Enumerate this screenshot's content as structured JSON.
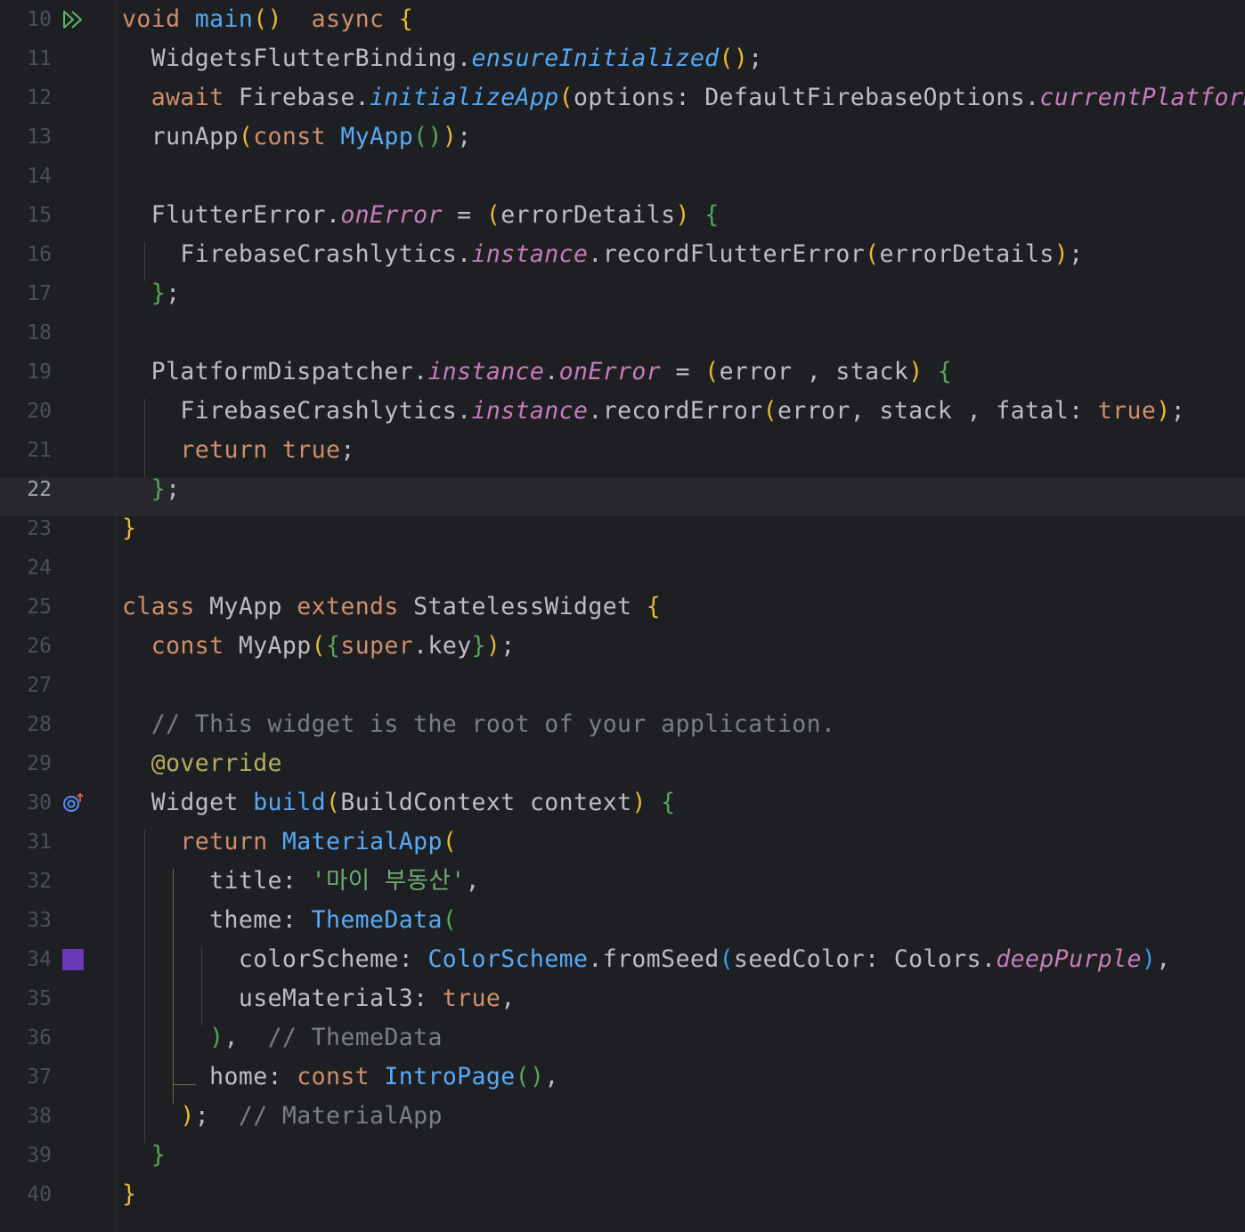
{
  "editor": {
    "active_line": "22",
    "swatch_color": "#673ab7",
    "lines": [
      {
        "n": "10",
        "icon": "run-gutter-icon",
        "segments": [
          [
            "kw",
            "void "
          ],
          [
            "fn",
            "main"
          ],
          [
            "p1",
            "()"
          ],
          [
            "",
            "  "
          ],
          [
            "kw",
            "async "
          ],
          [
            "p1",
            "{"
          ]
        ]
      },
      {
        "n": "11",
        "segments": [
          [
            "",
            "  WidgetsFlutterBinding."
          ],
          [
            "itb",
            "ensureInitialized"
          ],
          [
            "p1",
            "()"
          ],
          [
            "",
            ";"
          ]
        ]
      },
      {
        "n": "12",
        "segments": [
          [
            "kw",
            "  await "
          ],
          [
            "",
            "Firebase."
          ],
          [
            "itb",
            "initializeApp"
          ],
          [
            "p1",
            "("
          ],
          [
            "",
            "options: DefaultFirebaseOptions."
          ],
          [
            "it",
            "currentPlatform"
          ],
          [
            "p1",
            ")"
          ],
          [
            "",
            ";"
          ]
        ]
      },
      {
        "n": "13",
        "segments": [
          [
            "",
            "  runApp"
          ],
          [
            "p1",
            "("
          ],
          [
            "kw",
            "const "
          ],
          [
            "cls",
            "MyApp"
          ],
          [
            "p2",
            "()"
          ],
          [
            "p1",
            ")"
          ],
          [
            "",
            ";"
          ]
        ]
      },
      {
        "n": "14",
        "segments": []
      },
      {
        "n": "15",
        "segments": [
          [
            "",
            "  FlutterError."
          ],
          [
            "it",
            "onError"
          ],
          [
            "",
            " = "
          ],
          [
            "p1",
            "("
          ],
          [
            "",
            "errorDetails"
          ],
          [
            "p1",
            ")"
          ],
          [
            "",
            " "
          ],
          [
            "p2",
            "{"
          ]
        ]
      },
      {
        "n": "16",
        "segments": [
          [
            "",
            "    FirebaseCrashlytics."
          ],
          [
            "it",
            "instance"
          ],
          [
            "",
            ".recordFlutterError"
          ],
          [
            "p1",
            "("
          ],
          [
            "",
            "errorDetails"
          ],
          [
            "p1",
            ")"
          ],
          [
            "",
            ";"
          ]
        ]
      },
      {
        "n": "17",
        "segments": [
          [
            "",
            "  "
          ],
          [
            "p2",
            "}"
          ],
          [
            "",
            ";"
          ]
        ]
      },
      {
        "n": "18",
        "segments": []
      },
      {
        "n": "19",
        "segments": [
          [
            "",
            "  PlatformDispatcher."
          ],
          [
            "it",
            "instance"
          ],
          [
            "",
            "."
          ],
          [
            "it",
            "onError"
          ],
          [
            "",
            " = "
          ],
          [
            "p1",
            "("
          ],
          [
            "",
            "error , stack"
          ],
          [
            "p1",
            ")"
          ],
          [
            "",
            " "
          ],
          [
            "p2",
            "{"
          ]
        ]
      },
      {
        "n": "20",
        "segments": [
          [
            "",
            "    FirebaseCrashlytics."
          ],
          [
            "it",
            "instance"
          ],
          [
            "",
            ".recordError"
          ],
          [
            "p1",
            "("
          ],
          [
            "",
            "error, stack , fatal: "
          ],
          [
            "kw",
            "true"
          ],
          [
            "p1",
            ")"
          ],
          [
            "",
            ";"
          ]
        ]
      },
      {
        "n": "21",
        "segments": [
          [
            "kw",
            "    return true"
          ],
          [
            "",
            ";"
          ]
        ]
      },
      {
        "n": "22",
        "segments": [
          [
            "",
            "  "
          ],
          [
            "p2",
            "}"
          ],
          [
            "",
            ";"
          ]
        ]
      },
      {
        "n": "23",
        "segments": [
          [
            "p1",
            "}"
          ]
        ]
      },
      {
        "n": "24",
        "segments": []
      },
      {
        "n": "25",
        "segments": [
          [
            "kw",
            "class "
          ],
          [
            "",
            "MyApp "
          ],
          [
            "kw",
            "extends "
          ],
          [
            "",
            "StatelessWidget "
          ],
          [
            "p1",
            "{"
          ]
        ]
      },
      {
        "n": "26",
        "segments": [
          [
            "kw",
            "  const "
          ],
          [
            "",
            "MyApp"
          ],
          [
            "p1",
            "("
          ],
          [
            "p2",
            "{"
          ],
          [
            "kw",
            "super"
          ],
          [
            "",
            ".key"
          ],
          [
            "p2",
            "}"
          ],
          [
            "p1",
            ")"
          ],
          [
            "",
            ";"
          ]
        ]
      },
      {
        "n": "27",
        "segments": []
      },
      {
        "n": "28",
        "segments": [
          [
            "cm",
            "  // This widget is the root of your application."
          ]
        ]
      },
      {
        "n": "29",
        "segments": [
          [
            "ann",
            "  @override"
          ]
        ]
      },
      {
        "n": "30",
        "icon": "override-gutter-icon",
        "segments": [
          [
            "",
            "  Widget "
          ],
          [
            "fn",
            "build"
          ],
          [
            "p1",
            "("
          ],
          [
            "",
            "BuildContext context"
          ],
          [
            "p1",
            ")"
          ],
          [
            "",
            " "
          ],
          [
            "p2",
            "{"
          ]
        ]
      },
      {
        "n": "31",
        "segments": [
          [
            "kw",
            "    return "
          ],
          [
            "cls",
            "MaterialApp"
          ],
          [
            "p1",
            "("
          ]
        ]
      },
      {
        "n": "32",
        "segments": [
          [
            "",
            "      title: "
          ],
          [
            "str",
            "'마이 부동산'"
          ],
          [
            "",
            ","
          ]
        ]
      },
      {
        "n": "33",
        "segments": [
          [
            "",
            "      theme: "
          ],
          [
            "cls",
            "ThemeData"
          ],
          [
            "p2",
            "("
          ]
        ]
      },
      {
        "n": "34",
        "icon": "color-swatch",
        "segments": [
          [
            "",
            "        colorScheme: "
          ],
          [
            "cls",
            "ColorScheme"
          ],
          [
            "",
            ".fromSeed"
          ],
          [
            "p3",
            "("
          ],
          [
            "",
            "seedColor: Colors."
          ],
          [
            "it",
            "deepPurple"
          ],
          [
            "p3",
            ")"
          ],
          [
            "",
            ","
          ]
        ]
      },
      {
        "n": "35",
        "segments": [
          [
            "",
            "        useMaterial3: "
          ],
          [
            "kw",
            "true"
          ],
          [
            "",
            ","
          ]
        ]
      },
      {
        "n": "36",
        "segments": [
          [
            "",
            "      "
          ],
          [
            "p2",
            ")"
          ],
          [
            "",
            ",  "
          ],
          [
            "cm",
            "// ThemeData"
          ]
        ]
      },
      {
        "n": "37",
        "segments": [
          [
            "",
            "      home: "
          ],
          [
            "kw",
            "const "
          ],
          [
            "cls",
            "IntroPage"
          ],
          [
            "p2",
            "()"
          ],
          [
            "",
            ","
          ]
        ]
      },
      {
        "n": "38",
        "segments": [
          [
            "",
            "    "
          ],
          [
            "p1",
            ")"
          ],
          [
            "",
            ";  "
          ],
          [
            "cm",
            "// MaterialApp"
          ]
        ]
      },
      {
        "n": "39",
        "segments": [
          [
            "",
            "  "
          ],
          [
            "p2",
            "}"
          ]
        ]
      },
      {
        "n": "40",
        "segments": [
          [
            "p1",
            "}"
          ]
        ]
      }
    ]
  }
}
